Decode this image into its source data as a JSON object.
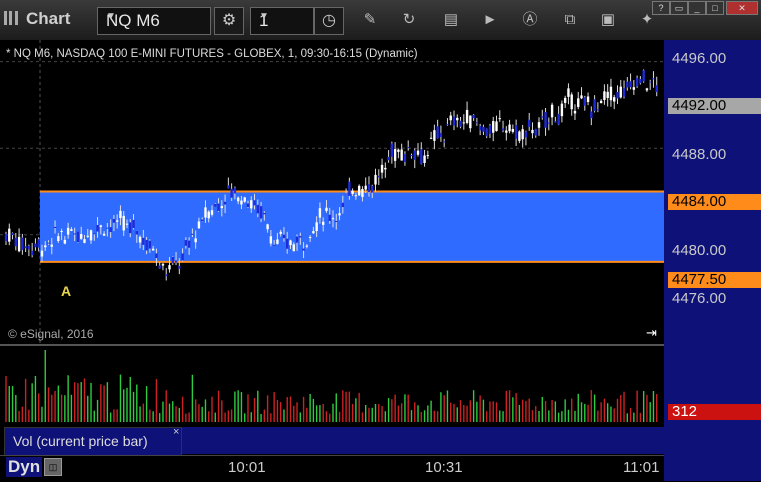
{
  "toolbar": {
    "title": "Chart",
    "symbol": "NQ M6",
    "interval": "1"
  },
  "chart": {
    "header": "* NQ M6, NASDAQ 100 E-MINI FUTURES - GLOBEX, 1, 09:30-16:15 (Dynamic)",
    "copyright": "© eSignal, 2016",
    "annotation": "A",
    "price_axis": [
      "4496.00",
      "4488.00",
      "4480.00",
      "4476.00"
    ],
    "last_price": "4492.00",
    "range_high": "4484.00",
    "range_low": "4477.50"
  },
  "volume": {
    "tab_label": "Vol (current price bar)",
    "close_glyph": "×",
    "last_value": "312"
  },
  "bottom": {
    "mode": "Dyn",
    "times": [
      "10:01",
      "10:31",
      "11:01"
    ]
  },
  "chart_data": {
    "type": "candlestick",
    "ylim": [
      4470,
      4498
    ],
    "range_high": 4484.0,
    "range_low": 4477.5,
    "last": 4492.0,
    "volume_last": 312
  },
  "colors": {
    "panel_bg": "#0d1178",
    "range_fill": "#2f6bff",
    "range_line": "#ff8c1a",
    "up_candle": "#ffffff",
    "down_candle": "#1e2bd6",
    "vol_up": "#2ecc40",
    "vol_down": "#cc2222"
  }
}
